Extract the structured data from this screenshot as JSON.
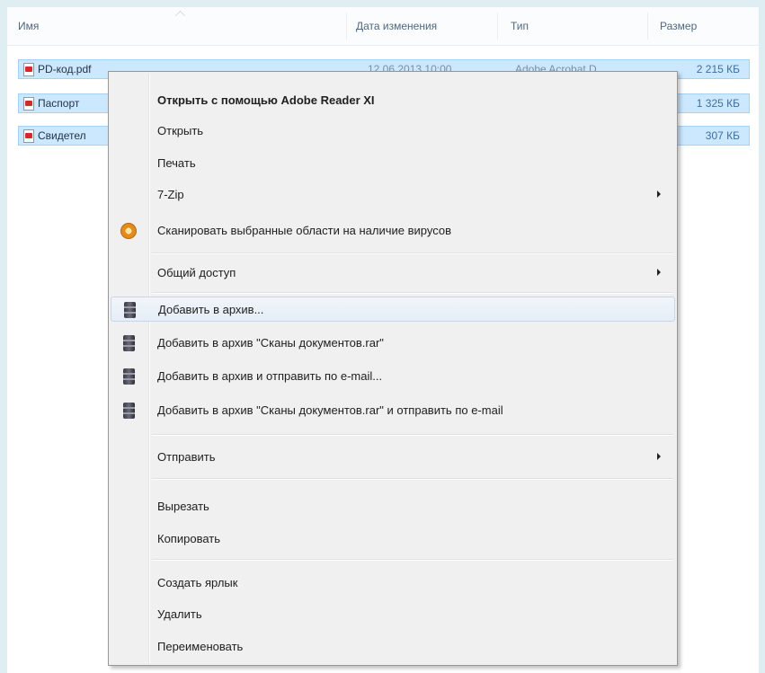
{
  "columns": {
    "name": "Имя",
    "date": "Дата изменения",
    "type": "Тип",
    "size": "Размер"
  },
  "files": [
    {
      "name": "PD-код.pdf",
      "date": "12.06.2013 10:00",
      "type": "Adobe Acrobat D...",
      "size": "2 215 КБ"
    },
    {
      "name": "Паспорт",
      "date": "",
      "type": "",
      "size": "1 325 КБ"
    },
    {
      "name": "Свидетел",
      "date": "",
      "type": "",
      "size": "307 КБ"
    }
  ],
  "context_menu": {
    "items": [
      {
        "label": "Открыть с помощью Adobe Reader XI",
        "bold": true
      },
      {
        "label": "Открыть"
      },
      {
        "label": "Печать"
      },
      {
        "label": "7-Zip",
        "submenu": true
      },
      {
        "label": "Сканировать выбранные области на наличие вирусов",
        "icon": "antivirus-scan-icon"
      },
      {
        "label": "Общий доступ",
        "submenu": true
      },
      {
        "label": "Добавить в архив...",
        "icon": "winrar-archive-icon"
      },
      {
        "label": "Добавить в архив \"Сканы документов.rar\"",
        "icon": "winrar-archive-icon"
      },
      {
        "label": "Добавить в архив и отправить по e-mail...",
        "icon": "winrar-archive-icon"
      },
      {
        "label": "Добавить в архив \"Сканы документов.rar\" и отправить по e-mail",
        "icon": "winrar-archive-icon"
      },
      {
        "label": "Отправить",
        "submenu": true
      },
      {
        "label": "Вырезать"
      },
      {
        "label": "Копировать"
      },
      {
        "label": "Создать ярлык"
      },
      {
        "label": "Удалить"
      },
      {
        "label": "Переименовать"
      }
    ]
  },
  "colors": {
    "selection_fill": "#cce8ff",
    "selection_border": "#a6d2f7",
    "menu_background": "#f0f0f0",
    "outer_background": "#dfeef2"
  }
}
